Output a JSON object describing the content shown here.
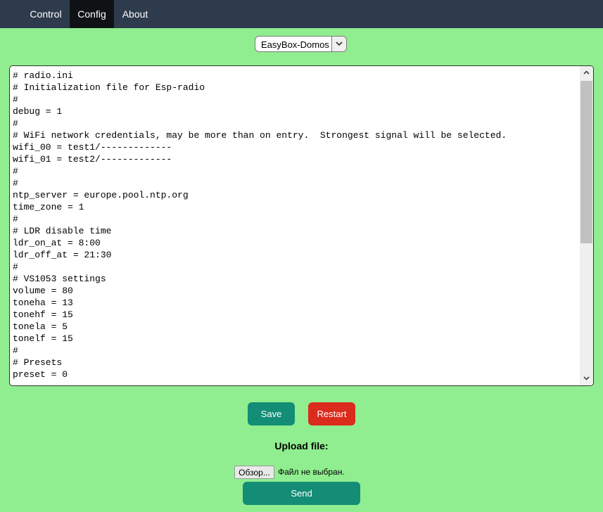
{
  "nav": {
    "tabs": [
      {
        "label": "Control"
      },
      {
        "label": "Config"
      },
      {
        "label": "About"
      }
    ],
    "active_tab": "Config"
  },
  "selector": {
    "selected": "EasyBox-Domos"
  },
  "editor": {
    "lines": [
      "# radio.ini",
      "# Initialization file for Esp-radio",
      "#",
      "debug = 1",
      "#",
      "# WiFi network credentials, may be more than on entry.  Strongest signal will be selected.",
      "wifi_00 = test1/-------------",
      "wifi_01 = test2/-------------",
      "#",
      "#",
      "ntp_server = europe.pool.ntp.org",
      "time_zone = 1",
      "#",
      "# LDR disable time",
      "ldr_on_at = 8:00",
      "ldr_off_at = 21:30",
      "#",
      "# VS1053 settings",
      "volume = 80",
      "toneha = 13",
      "tonehf = 15",
      "tonela = 5",
      "tonelf = 15",
      "#",
      "# Presets",
      "preset = 0"
    ]
  },
  "buttons": {
    "save": "Save",
    "restart": "Restart",
    "send": "Send"
  },
  "upload": {
    "label": "Upload file:",
    "browse": "Обзор...",
    "status": "Файл не выбран."
  },
  "colors": {
    "nav_bg": "#2e3b4d",
    "nav_active": "#0f1215",
    "page_bg": "#90ee90",
    "save": "#138d75",
    "restart": "#db2b1d",
    "send": "#138d75"
  }
}
